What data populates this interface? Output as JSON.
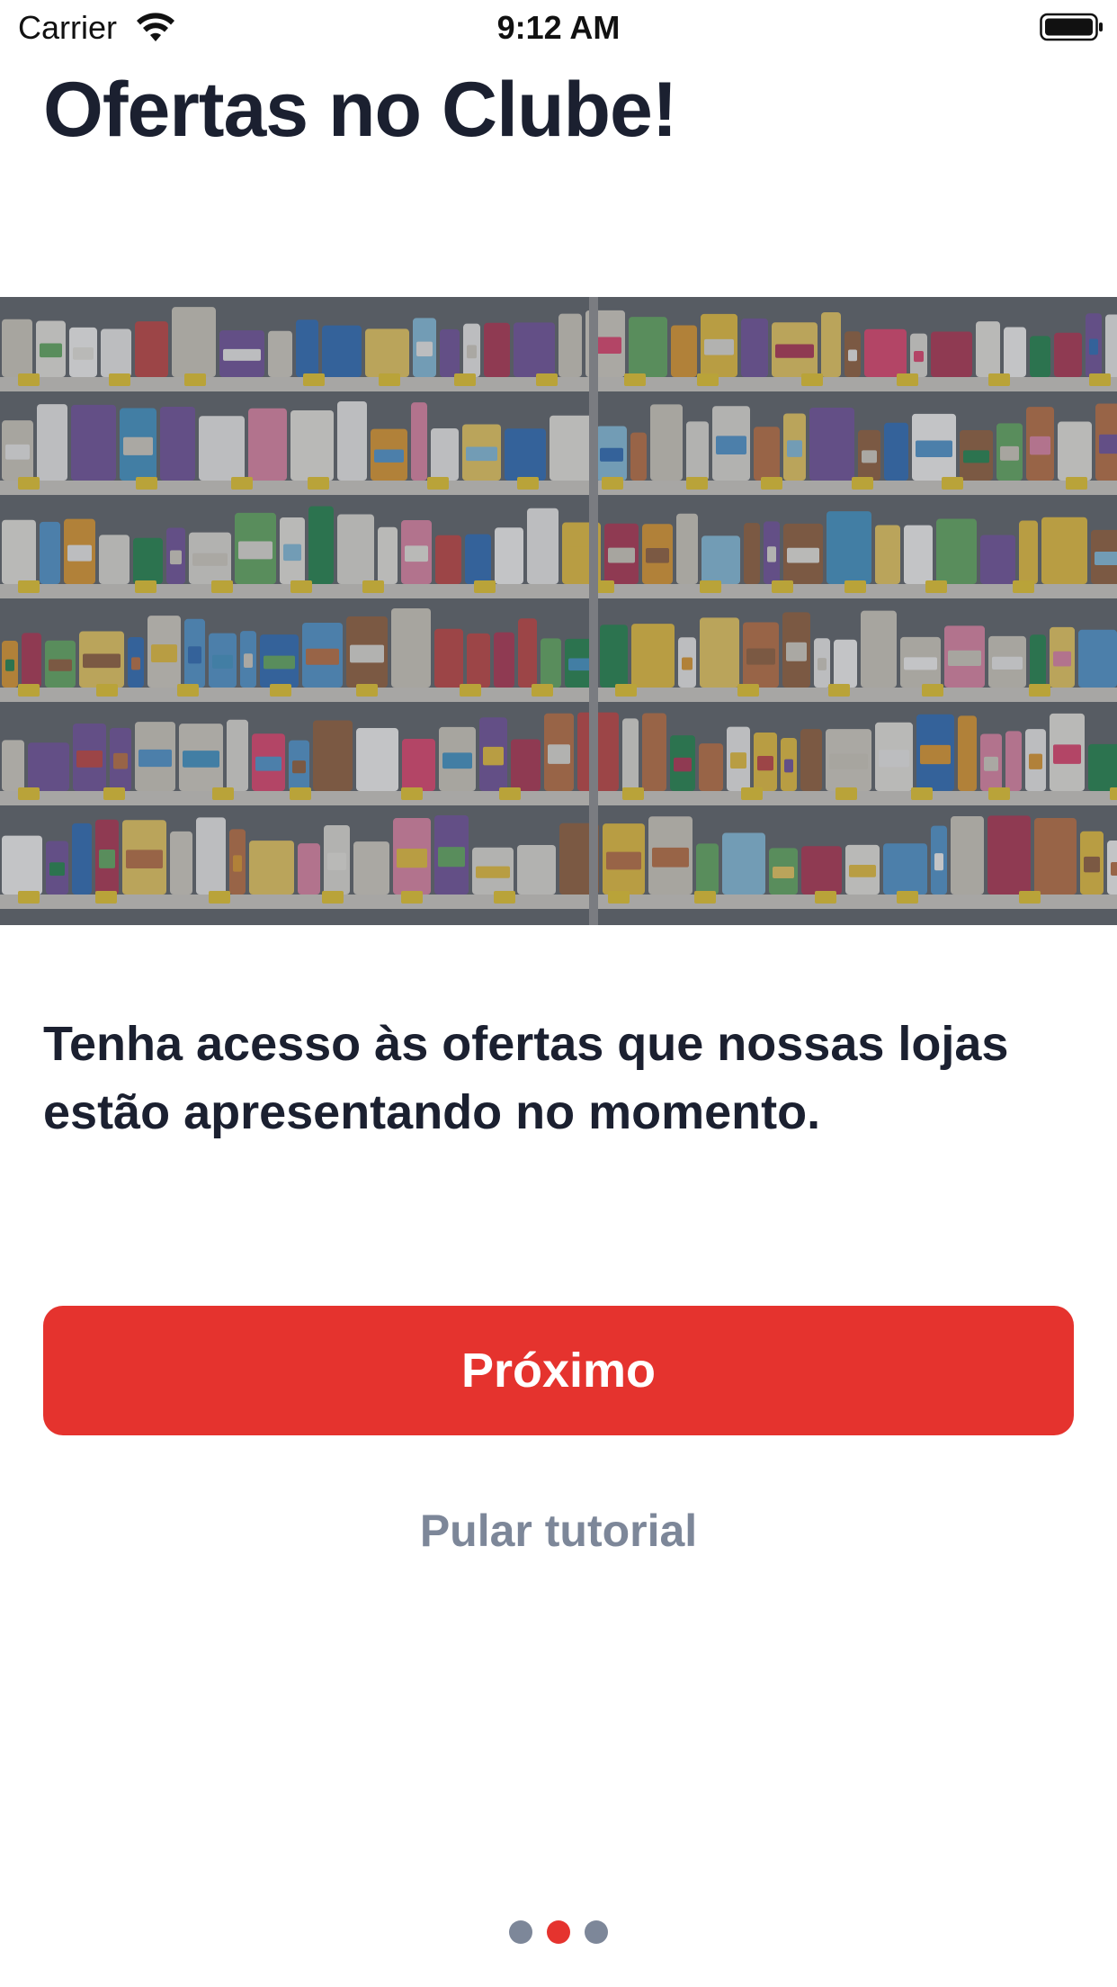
{
  "status_bar": {
    "carrier": "Carrier",
    "time": "9:12 AM",
    "icons": [
      "wifi-icon",
      "battery-icon"
    ]
  },
  "title": "Ofertas no Clube!",
  "hero": {
    "icon": "supermarket-shelves-photo"
  },
  "description": "Tenha acesso às ofertas que nossas lojas estão apresentando no momento.",
  "buttons": {
    "next_label": "Próximo",
    "skip_label": "Pular tutorial"
  },
  "pagination": {
    "total": 3,
    "current": 2
  },
  "colors": {
    "accent": "#e5332e",
    "text": "#1b2030",
    "muted": "#7d8799",
    "background": "#ffffff"
  }
}
